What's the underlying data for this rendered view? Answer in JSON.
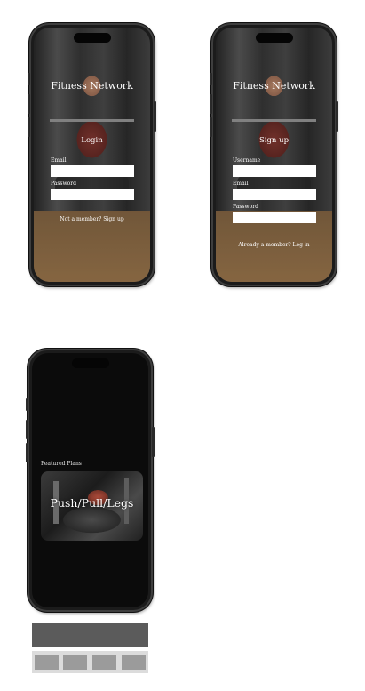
{
  "login_screen": {
    "app_title": "Fitness Network",
    "heading": "Login",
    "fields": [
      {
        "label": "Email",
        "value": ""
      },
      {
        "label": "Password",
        "value": ""
      }
    ],
    "switch_link": "Not a member? Sign up"
  },
  "signup_screen": {
    "app_title": "Fitness Network",
    "heading": "Sign up",
    "fields": [
      {
        "label": "Username",
        "value": ""
      },
      {
        "label": "Email",
        "value": ""
      },
      {
        "label": "Password",
        "value": ""
      }
    ],
    "switch_link": "Already a member? Log in"
  },
  "home_screen": {
    "section_label": "Featured Plans",
    "plans": [
      {
        "title": "Push/Pull/Legs"
      }
    ]
  },
  "wireframe": {
    "tabs": [
      "",
      "",
      "",
      ""
    ]
  },
  "colors": {
    "phone_frame": "#1b1b1b",
    "dark_screen": "#0b0b0b",
    "nav_bar": "#5b5b5b",
    "tab_strip": "#dcdcdc",
    "tab": "#9b9b9b"
  }
}
